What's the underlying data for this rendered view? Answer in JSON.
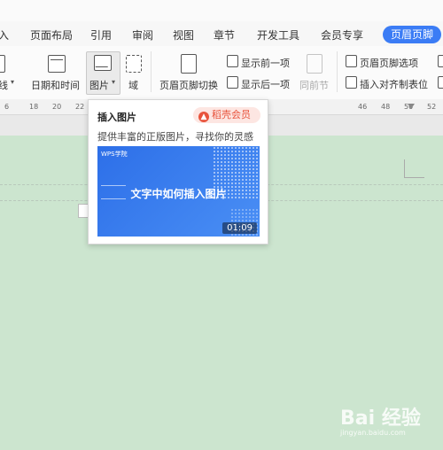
{
  "tabs": [
    "入",
    "页面布局",
    "引用",
    "审阅",
    "视图",
    "章节",
    "开发工具",
    "会员专享"
  ],
  "active_tab": "页眉页脚",
  "ribbon": {
    "line_label": "线",
    "datetime_label": "日期和时间",
    "picture_label": "图片",
    "field_label": "域",
    "switch_label": "页眉页脚切换",
    "show_prev_label": "显示前一项",
    "show_next_label": "显示后一项",
    "same_as_prev_label": "同前节",
    "options_label": "页眉页脚选项",
    "insert_align_label": "插入对齐制表位"
  },
  "ruler_numbers": [
    "6",
    "18",
    "20",
    "22",
    "46",
    "48",
    "50",
    "52"
  ],
  "popup": {
    "title": "插入图片",
    "member_label": "稻壳会员",
    "description": "提供丰富的正版图片，寻找你的灵感",
    "video_brand": "WPS学院",
    "video_title": "文字中如何插入图片",
    "video_duration": "01:09"
  },
  "watermark": {
    "brand": "Bai 经验",
    "url": "jingyan.baidu.com"
  },
  "colors": {
    "accent": "#3b7cf5",
    "document_bg": "#cce5cf",
    "member_red": "#e8533c"
  }
}
